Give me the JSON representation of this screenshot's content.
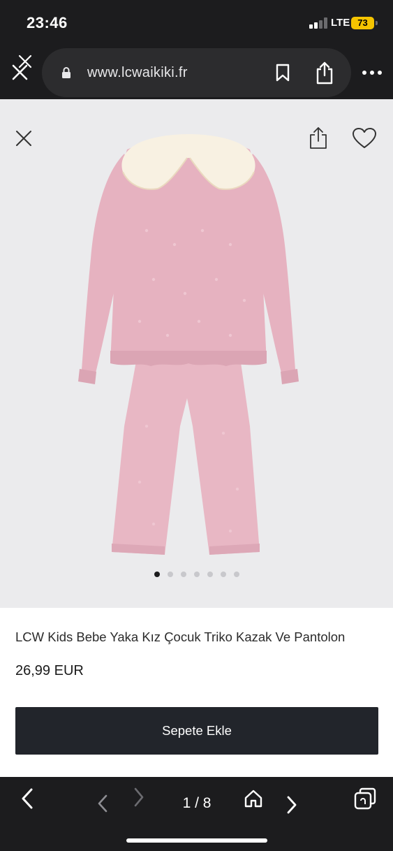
{
  "status_bar": {
    "time": "23:46",
    "network": "LTE",
    "battery": "73",
    "battery_color": "#f5c400"
  },
  "browser": {
    "url": "www.lcwaikiki.fr",
    "icons": [
      "close-tab-icon",
      "lock-icon",
      "bookmark-icon",
      "share-icon",
      "more-icon"
    ]
  },
  "product": {
    "title": "LCW Kids Bebe Yaka Kız Çocuk Triko Kazak Ve Pantolon",
    "price": "26,99 EUR",
    "add_to_cart_label": "Sepete Ekle",
    "image_count": 7,
    "active_image_index": 0,
    "outfit_color": "#e6b2c0",
    "collar_color": "#f8f1e2"
  },
  "image_actions": {
    "icons": [
      "close-icon",
      "share-icon",
      "heart-icon"
    ]
  },
  "bottom_bar": {
    "page_counter": "1 / 8",
    "icons": [
      "back-icon",
      "page-prev-icon",
      "page-next-icon",
      "home-icon",
      "next-icon",
      "tabs-icon"
    ]
  }
}
